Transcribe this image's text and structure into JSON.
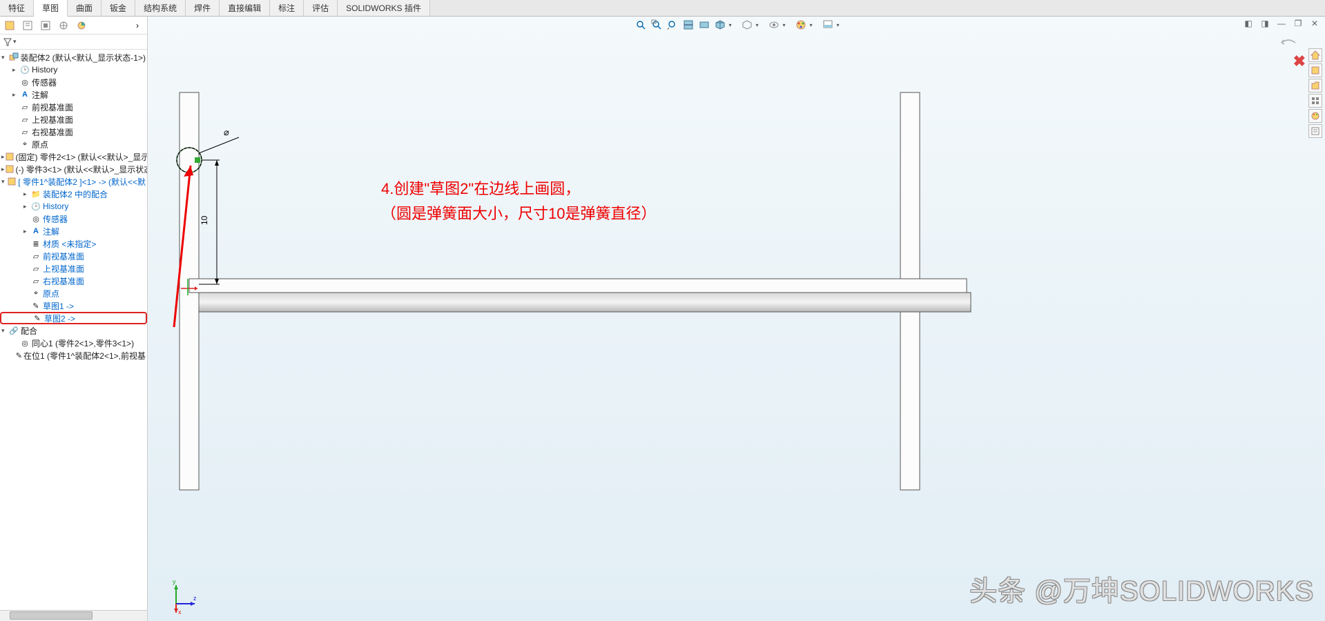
{
  "tabs": [
    "特征",
    "草图",
    "曲面",
    "钣金",
    "结构系统",
    "焊件",
    "直接编辑",
    "标注",
    "评估",
    "SOLIDWORKS 插件"
  ],
  "activeTab": "草图",
  "tree": {
    "root": "装配体2 (默认<默认_显示状态-1>)",
    "items": [
      {
        "level": 1,
        "exp": "▸",
        "ico": "📁",
        "label": "History",
        "blue": false
      },
      {
        "level": 1,
        "exp": "",
        "ico": "📷",
        "label": "传感器",
        "blue": false
      },
      {
        "level": 1,
        "exp": "▸",
        "ico": "A",
        "label": "注解",
        "blue": false
      },
      {
        "level": 1,
        "exp": "",
        "ico": "◫",
        "label": "前视基准面",
        "blue": false
      },
      {
        "level": 1,
        "exp": "",
        "ico": "◫",
        "label": "上视基准面",
        "blue": false
      },
      {
        "level": 1,
        "exp": "",
        "ico": "◫",
        "label": "右视基准面",
        "blue": false
      },
      {
        "level": 1,
        "exp": "",
        "ico": "↳",
        "label": "原点",
        "blue": false
      },
      {
        "level": 0,
        "exp": "▸",
        "ico": "🧩",
        "label": "(固定) 零件2<1> (默认<<默认>_显示",
        "blue": false,
        "gold": true
      },
      {
        "level": 0,
        "exp": "▸",
        "ico": "🧩",
        "label": "(-) 零件3<1> (默认<<默认>_显示状态",
        "blue": false,
        "gold": true
      },
      {
        "level": 0,
        "exp": "▾",
        "ico": "🧩",
        "label": "[ 零件1^装配体2 ]<1> -> (默认<<默",
        "blue": true,
        "gold": true
      },
      {
        "level": 1,
        "exp": "▸",
        "ico": "📁",
        "label": "装配体2 中的配合",
        "blue": true
      },
      {
        "level": 1,
        "exp": "▸",
        "ico": "📁",
        "label": "History",
        "blue": true
      },
      {
        "level": 1,
        "exp": "",
        "ico": "📷",
        "label": "传感器",
        "blue": true
      },
      {
        "level": 1,
        "exp": "▸",
        "ico": "A",
        "label": "注解",
        "blue": true
      },
      {
        "level": 1,
        "exp": "",
        "ico": "≡",
        "label": "材质 <未指定>",
        "blue": true
      },
      {
        "level": 1,
        "exp": "",
        "ico": "◫",
        "label": "前视基准面",
        "blue": true
      },
      {
        "level": 1,
        "exp": "",
        "ico": "◫",
        "label": "上视基准面",
        "blue": true
      },
      {
        "level": 1,
        "exp": "",
        "ico": "◫",
        "label": "右视基准面",
        "blue": true
      },
      {
        "level": 1,
        "exp": "",
        "ico": "↳",
        "label": "原点",
        "blue": true
      },
      {
        "level": 1,
        "exp": "",
        "ico": "✎",
        "label": "草图1 ->",
        "blue": true
      },
      {
        "level": 1,
        "exp": "",
        "ico": "✎",
        "label": "草图2 ->",
        "blue": true,
        "hilite": true
      },
      {
        "level": 0,
        "exp": "▾",
        "ico": "🔗",
        "label": "配合",
        "blue": false
      },
      {
        "level": 1,
        "exp": "",
        "ico": "◎",
        "label": "同心1 (零件2<1>,零件3<1>)",
        "blue": false
      },
      {
        "level": 1,
        "exp": "",
        "ico": "✎",
        "label": "在位1 (零件1^装配体2<1>,前视基",
        "blue": false
      }
    ]
  },
  "annotation": {
    "line1": "4.创建\"草图2\"在边线上画圆，",
    "line2": "（圆是弹簧面大小，尺寸10是弹簧直径）"
  },
  "dimension_label": "⌀",
  "dimension_value": "10",
  "watermark": "头条 @万坤SOLIDWORKS",
  "triad_axes": {
    "x": "x",
    "y": "y",
    "z": "z"
  }
}
